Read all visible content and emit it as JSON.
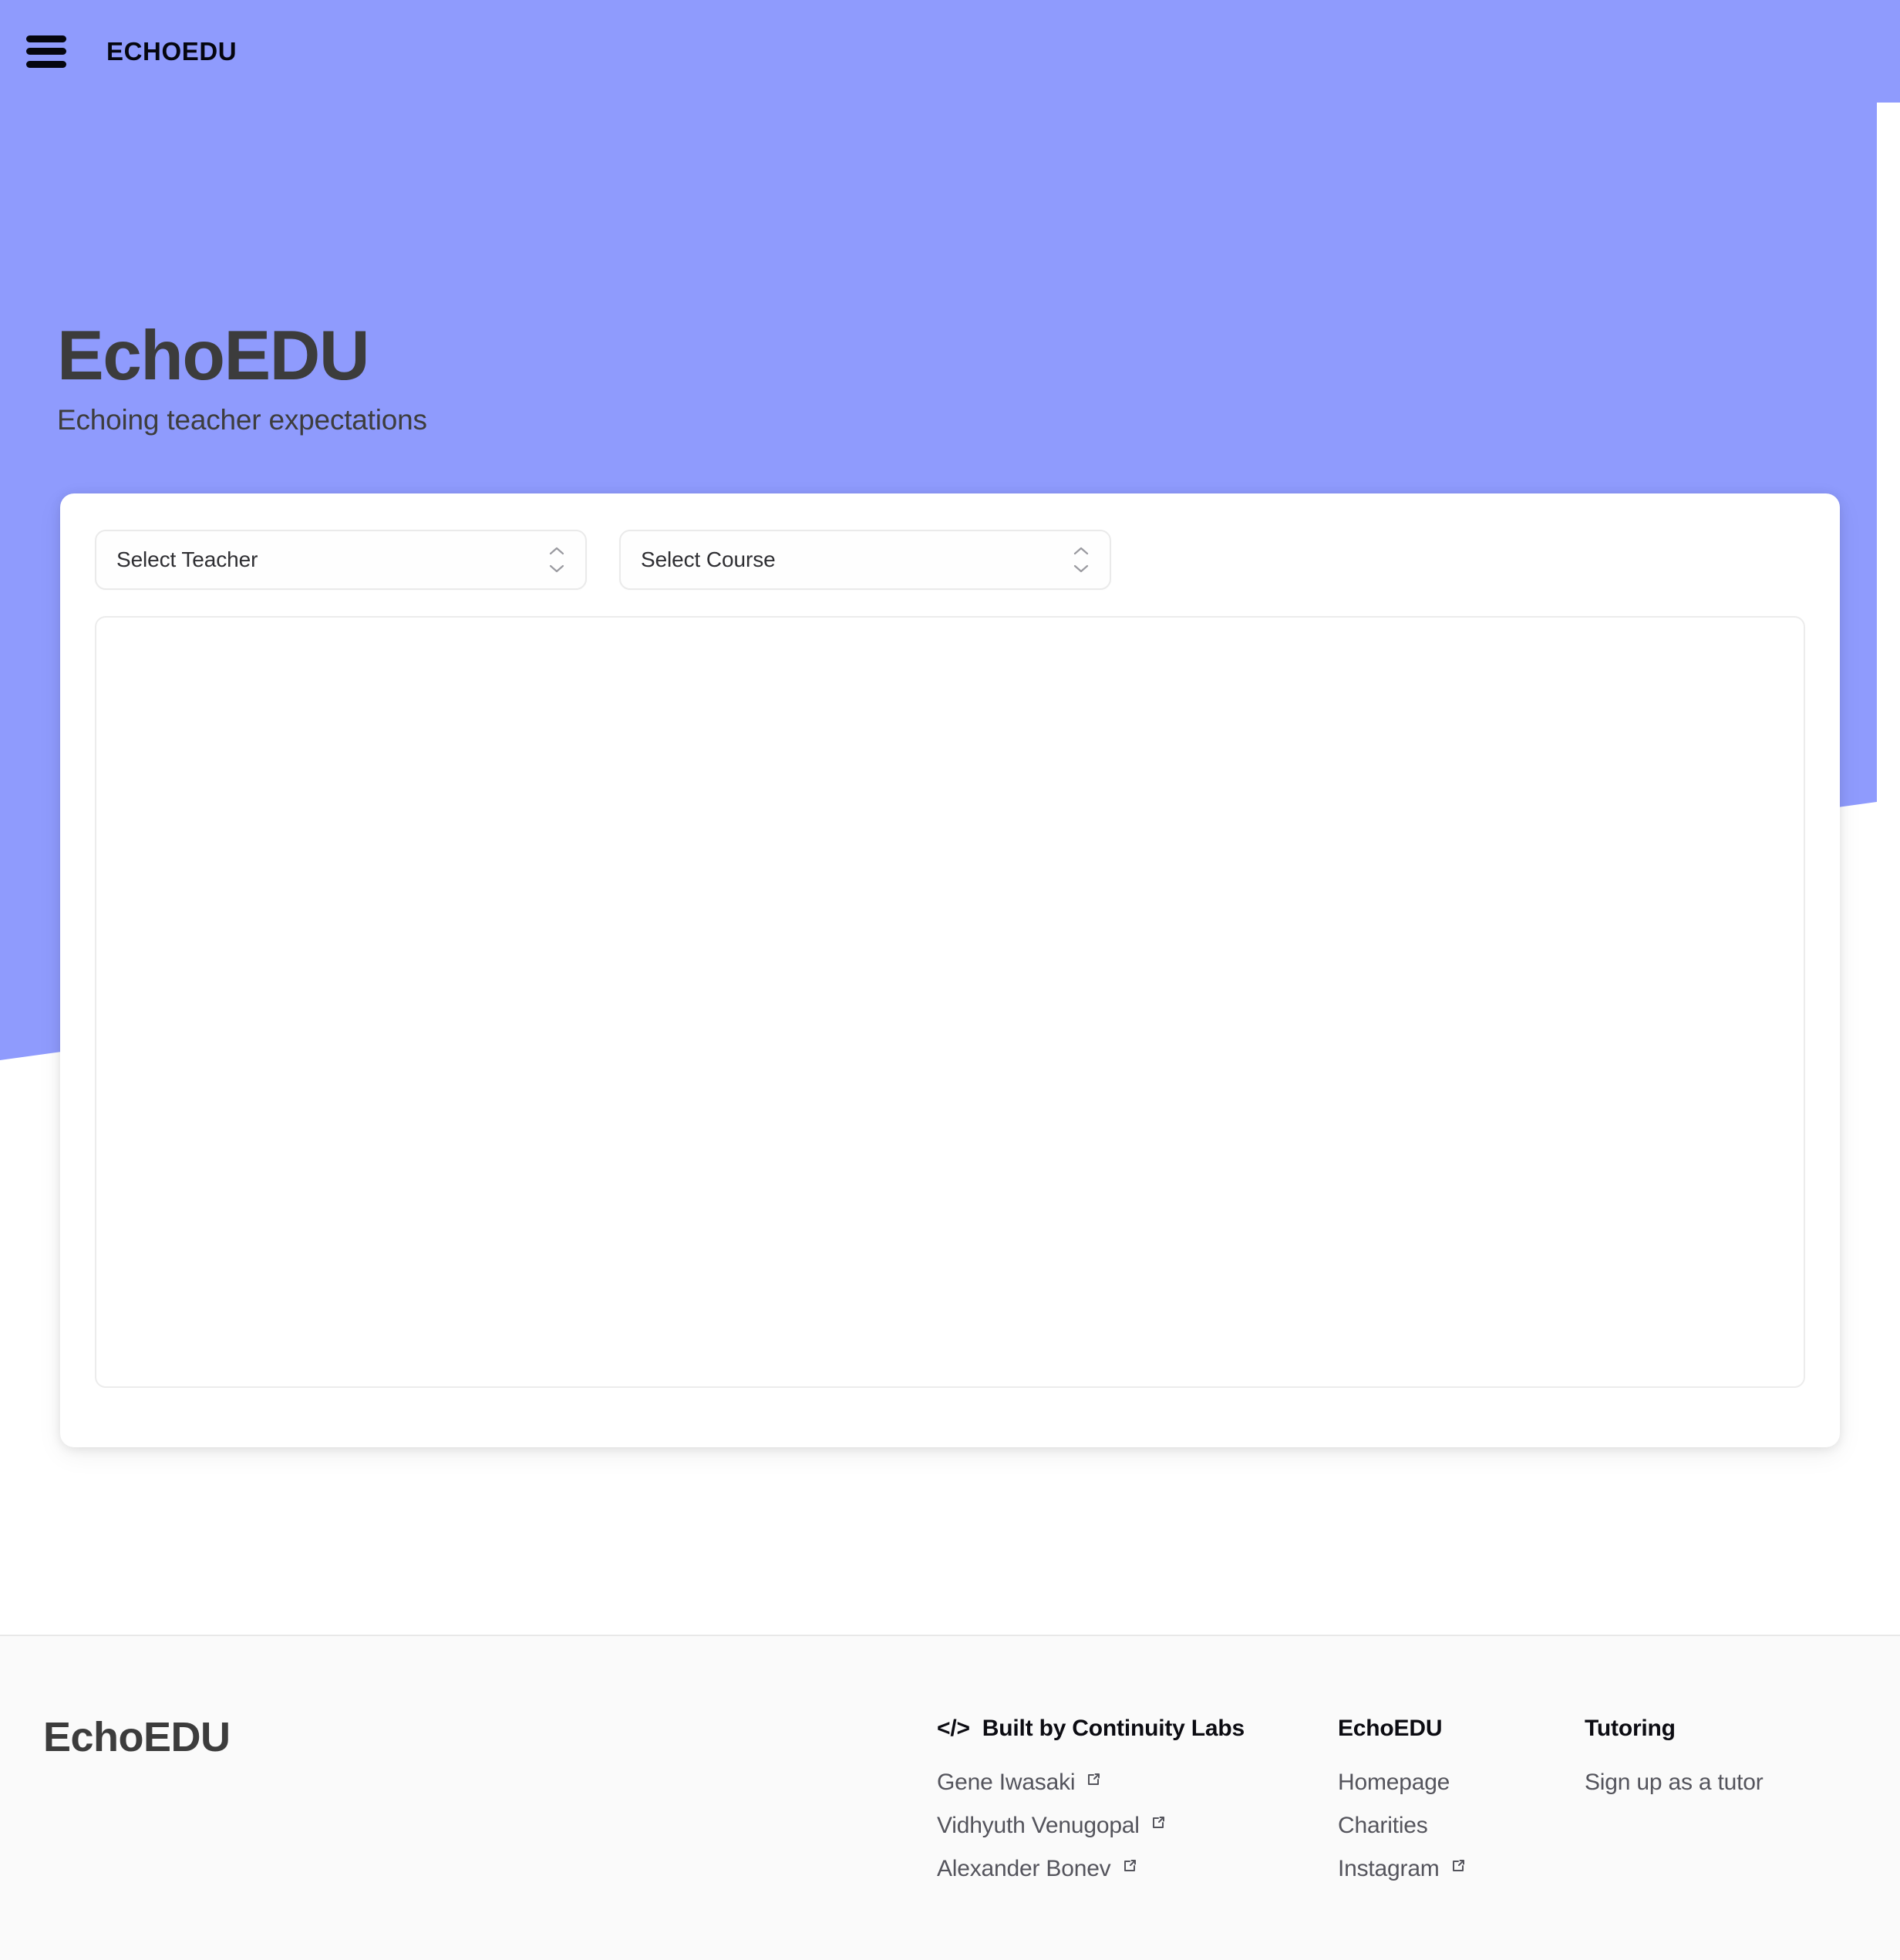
{
  "nav": {
    "menu_icon": "hamburger-menu-icon",
    "brand": "ECHOEDU"
  },
  "hero": {
    "title": "EchoEDU",
    "subtitle": "Echoing teacher expectations",
    "background_color": "#8f9bfd"
  },
  "card": {
    "selects": [
      {
        "name": "teacher",
        "value": "Select Teacher",
        "icon": "chevron-updown-icon"
      },
      {
        "name": "course",
        "value": "Select Course",
        "icon": "chevron-updown-icon"
      }
    ],
    "content_panel": ""
  },
  "footer": {
    "brand": "EchoEDU",
    "columns": [
      {
        "heading": "Built by Continuity Labs",
        "icon": "code-brackets-icon",
        "links": [
          {
            "label": "Gene Iwasaki",
            "external": true
          },
          {
            "label": "Vidhyuth Venugopal",
            "external": true
          },
          {
            "label": "Alexander Bonev",
            "external": true
          }
        ]
      },
      {
        "heading": "EchoEDU",
        "icon": "",
        "links": [
          {
            "label": "Homepage",
            "external": false
          },
          {
            "label": "Charities",
            "external": false
          },
          {
            "label": "Instagram",
            "external": true
          }
        ]
      },
      {
        "heading": "Tutoring",
        "icon": "",
        "links": [
          {
            "label": "Sign up as a tutor",
            "external": false
          }
        ]
      }
    ]
  }
}
